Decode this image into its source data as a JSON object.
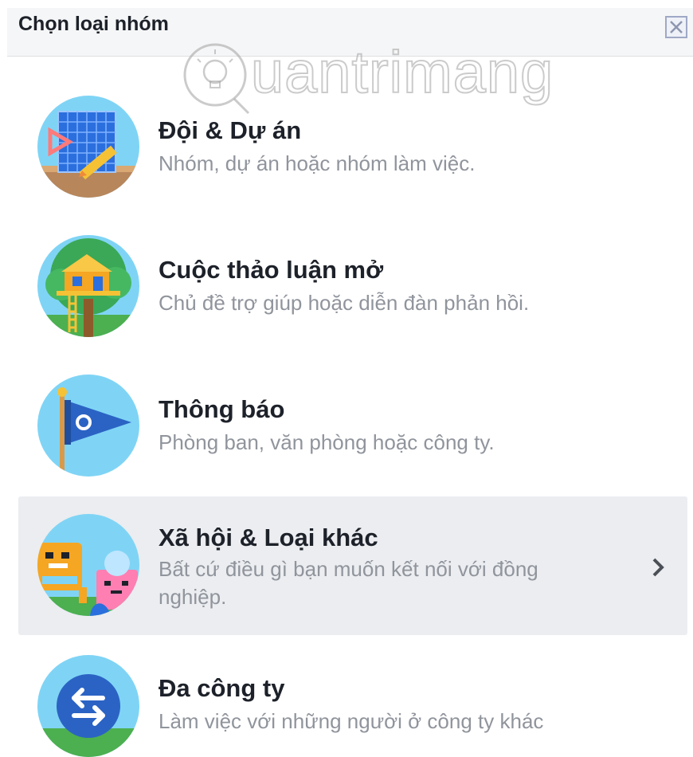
{
  "dialog": {
    "title": "Chọn loại nhóm"
  },
  "watermark": {
    "text": "uantrimang"
  },
  "options": [
    {
      "title": "Đội & Dự án",
      "description": "Nhóm, dự án hoặc nhóm làm việc.",
      "icon": "blueprint-icon"
    },
    {
      "title": "Cuộc thảo luận mở",
      "description": "Chủ đề trợ giúp hoặc diễn đàn phản hồi.",
      "icon": "treehouse-icon"
    },
    {
      "title": "Thông báo",
      "description": "Phòng ban, văn phòng hoặc công ty.",
      "icon": "pennant-flag-icon"
    },
    {
      "title": "Xã hội & Loại khác",
      "description": "Bất cứ điều gì bạn muốn kết nối với đồng nghiệp.",
      "icon": "robots-icon",
      "selected": true
    },
    {
      "title": "Đa công ty",
      "description": "Làm việc với những người ở công ty khác",
      "icon": "swap-arrows-icon"
    }
  ],
  "colors": {
    "header_bg": "#f5f6f7",
    "selected_bg": "#ebedf0",
    "title_text": "#1d2129",
    "description_text": "#90949c",
    "icon_sky": "#7fd4f5"
  }
}
